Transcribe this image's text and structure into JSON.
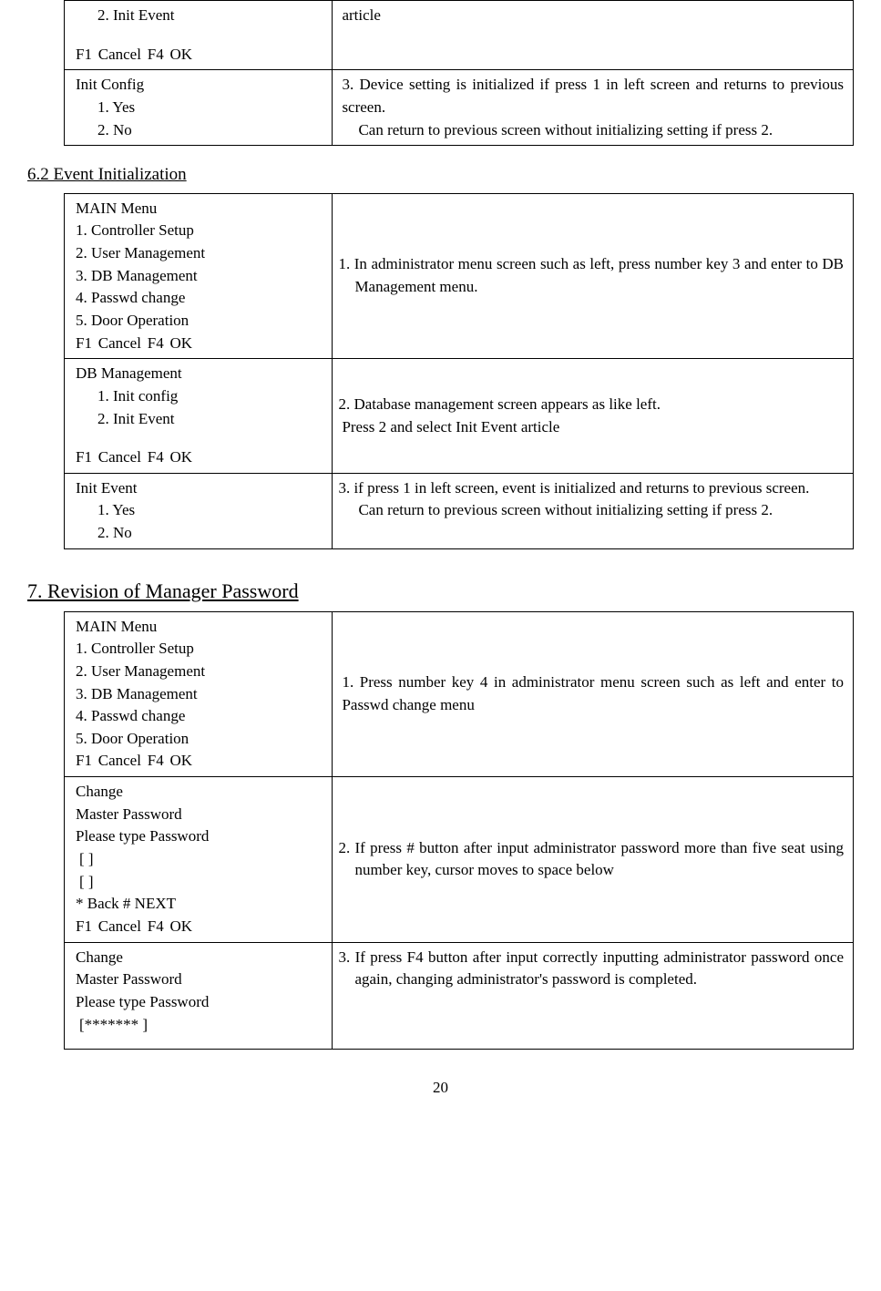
{
  "section_6_1": {
    "row1": {
      "left": {
        "item2": "2.  Init Event",
        "footer": "F1 Cancel     F4 OK"
      },
      "right": "article"
    },
    "row2": {
      "left": {
        "title": "Init  Config",
        "item1": "1.  Yes",
        "item2": "2.  No"
      },
      "right": {
        "line1": "3. Device setting is initialized if press 1 in left screen and returns to previous screen.",
        "line2": "Can return to previous screen without initializing setting if press 2."
      }
    }
  },
  "section_6_2": {
    "title": "6.2 Event Initialization",
    "row1": {
      "left": {
        "title": "MAIN Menu",
        "item1": "1.   Controller Setup",
        "item2": "2.   User Management",
        "item3": "3.   DB Management",
        "item4": "4.   Passwd change",
        "item5": "5.   Door Operation",
        "footer": "F1 Cancel     F4 OK"
      },
      "right": "1. In administrator menu screen such as left, press number key 3 and enter to DB Management menu."
    },
    "row2": {
      "left": {
        "title": "DB Management",
        "item1": "1.  Init config",
        "item2": "2.  Init Event",
        "footer": "F1 Cancel     F4 OK"
      },
      "right": {
        "line1": "2. Database management screen appears as like left.",
        "line2": "Press 2 and select Init Event article"
      }
    },
    "row3": {
      "left": {
        "title": "Init  Event",
        "item1": "1.  Yes",
        "item2": "2.  No"
      },
      "right": {
        "line1": "3. if press 1 in left screen, event is initialized and returns to previous screen.",
        "line2": "Can return to previous screen without initializing setting if press 2."
      }
    }
  },
  "section_7": {
    "title": "7. Revision of Manager Password",
    "row1": {
      "left": {
        "title": "MAIN Menu",
        "item1": "1.   Controller Setup",
        "item2": "2.   User Management",
        "item3": "3.   DB Management",
        "item4": "4.   Passwd change",
        "item5": "5.   Door Operation",
        "footer": "F1 Cancel     F4 OK"
      },
      "right": "1. Press number key 4 in administrator menu screen such as left and enter to Passwd change menu"
    },
    "row2": {
      "left": {
        "l1": "Change",
        "l2": "Master  Password",
        "l3": "Please  type  Password",
        "l4": "[                            ]",
        "l5": "[                            ]",
        "l6": " *   Back         #  NEXT",
        "footer": "F1 Cancel     F4 OK"
      },
      "right": "2. If press # button after input administrator password more than five seat using number key, cursor moves to space below"
    },
    "row3": {
      "left": {
        "l1": "Change",
        "l2": "Master  Password",
        "l3": "Please  type  Password",
        "l4": "  [*******                     ]"
      },
      "right": "3. If press F4 button after input correctly inputting administrator password once again, changing administrator's password is completed."
    }
  },
  "page_number": "20"
}
